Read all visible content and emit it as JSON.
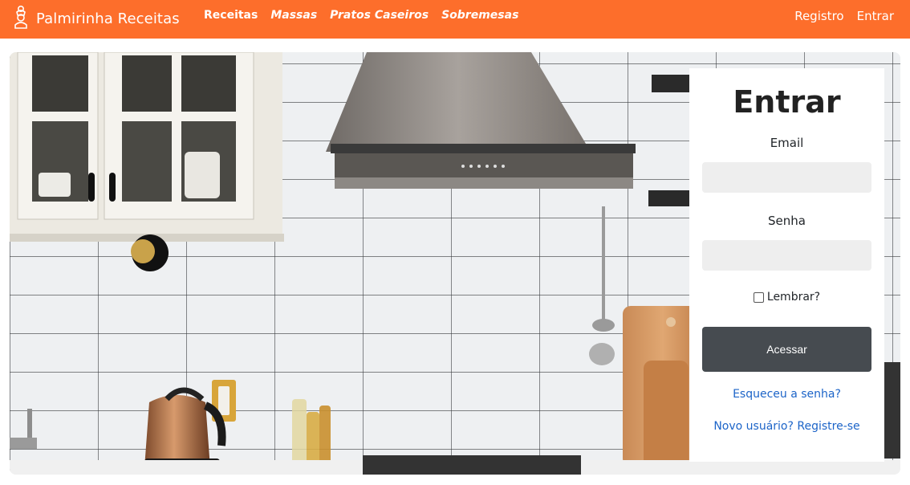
{
  "navbar": {
    "brand": "Palmirinha Receitas",
    "links": [
      "Receitas",
      "Massas",
      "Pratos Caseiros",
      "Sobremesas"
    ],
    "register": "Registro",
    "login": "Entrar"
  },
  "login": {
    "title": "Entrar",
    "email_label": "Email",
    "password_label": "Senha",
    "remember_label": "Lembrar?",
    "submit": "Acessar",
    "forgot": "Esqueceu a senha?",
    "register": "Novo usuário? Registre-se"
  },
  "colors": {
    "accent": "#fd6e2b",
    "button": "#464b50",
    "link": "#1c64c8"
  }
}
